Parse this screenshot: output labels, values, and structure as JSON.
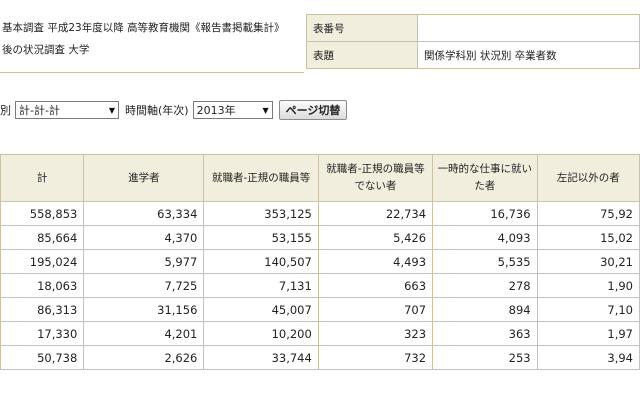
{
  "info": {
    "left_line1": "基本調査 平成23年度以降 高等教育機関《報告書掲載集計》",
    "left_line2": "後の状況調査 大学",
    "rows": [
      {
        "key": "表番号",
        "value": ""
      },
      {
        "key": "表題",
        "value": "関係学科別 状況別 卒業者数"
      }
    ]
  },
  "controls": {
    "label_prefix": "別",
    "category_select": "計-計-計",
    "time_label": "時間軸(年次)",
    "year_select": "2013年",
    "page_button": "ページ切替"
  },
  "table": {
    "headers": [
      "計",
      "進学者",
      "就職者-正規の職員等",
      "就職者-正規の職員等でない者",
      "一時的な仕事に就いた者",
      "左記以外の者"
    ],
    "rows": [
      [
        "558,853",
        "63,334",
        "353,125",
        "22,734",
        "16,736",
        "75,92"
      ],
      [
        "85,664",
        "4,370",
        "53,155",
        "5,426",
        "4,093",
        "15,02"
      ],
      [
        "195,024",
        "5,977",
        "140,507",
        "4,493",
        "5,535",
        "30,21"
      ],
      [
        "18,063",
        "7,725",
        "7,131",
        "663",
        "278",
        "1,90"
      ],
      [
        "86,313",
        "31,156",
        "45,007",
        "707",
        "894",
        "7,10"
      ],
      [
        "17,330",
        "4,201",
        "10,200",
        "323",
        "363",
        "1,97"
      ],
      [
        "50,738",
        "2,626",
        "33,744",
        "732",
        "253",
        "3,94"
      ]
    ]
  }
}
